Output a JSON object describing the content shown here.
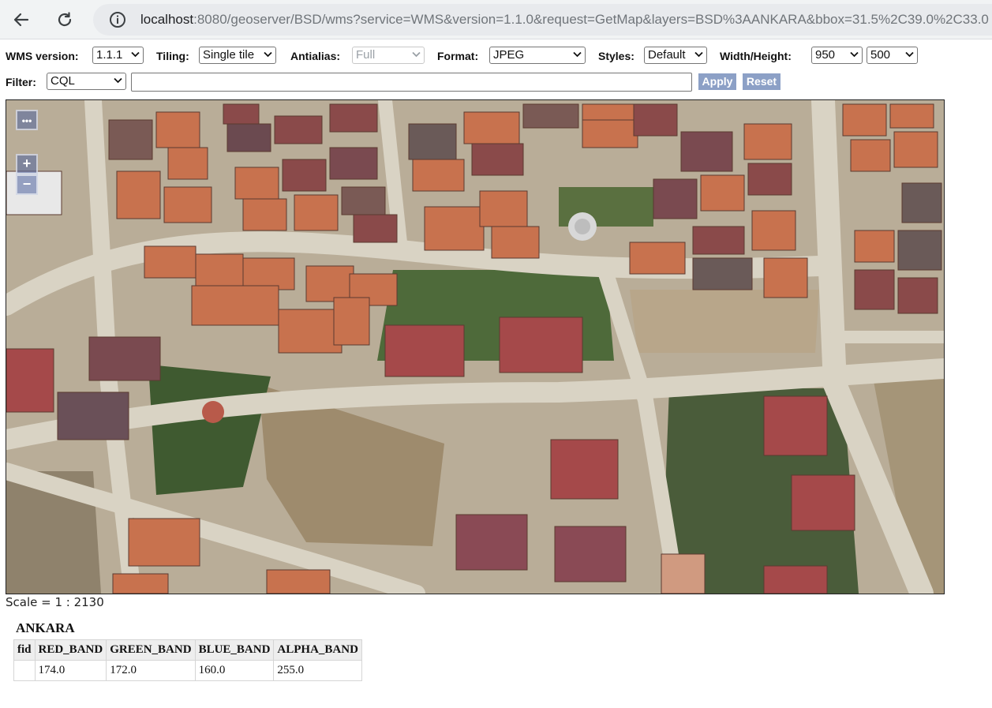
{
  "browser": {
    "back_icon": "arrow-left-icon",
    "reload_icon": "reload-icon",
    "info_icon": "info-icon",
    "url_host": "localhost",
    "url_rest": ":8080/geoserver/BSD/wms?service=WMS&version=1.1.0&request=GetMap&layers=BSD%3AANKARA&bbox=31.5%2C39.0%2C33.0"
  },
  "toolbar": {
    "wms_version_label": "WMS version:",
    "wms_version_value": "1.1.1",
    "tiling_label": "Tiling:",
    "tiling_value": "Single tile",
    "antialias_label": "Antialias:",
    "antialias_value": "Full",
    "format_label": "Format:",
    "format_value": "JPEG",
    "styles_label": "Styles:",
    "styles_value": "Default",
    "size_label": "Width/Height:",
    "width_value": "950",
    "height_value": "500"
  },
  "filter": {
    "label": "Filter:",
    "type_value": "CQL",
    "input_value": "",
    "apply_label": "Apply",
    "reset_label": "Reset"
  },
  "map": {
    "toggle_label": "•••",
    "zoom_in_label": "+",
    "zoom_out_label": "−"
  },
  "scale": "Scale = 1 : 2130",
  "feature_info": {
    "layer": "ANKARA",
    "columns": [
      "fid",
      "RED_BAND",
      "GREEN_BAND",
      "BLUE_BAND",
      "ALPHA_BAND"
    ],
    "row": [
      "",
      "174.0",
      "172.0",
      "160.0",
      "255.0"
    ]
  }
}
